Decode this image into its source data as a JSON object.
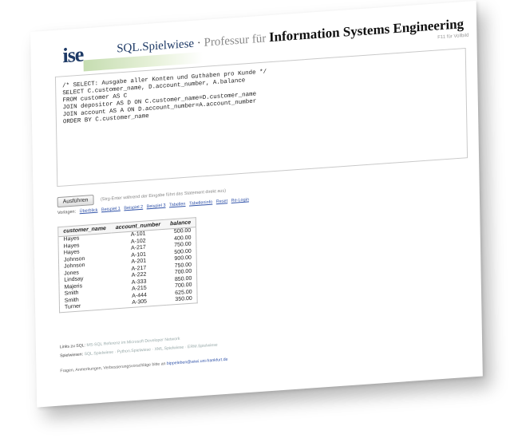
{
  "header": {
    "app_name": "SQL.Spielwiese",
    "separator": " · ",
    "prof_text": "Professur für",
    "ise_text": "Information Systems Engineering",
    "logo_text": "ise",
    "topright": "F11 für Vollbild"
  },
  "editor": {
    "sql": "/* SELECT: Ausgabe aller Konten und Guthaben pro Kunde */\nSELECT C.customer_name, D.account_number, A.balance\nFROM customer AS C\nJOIN depositor AS D ON C.customer_name=D.customer_name\nJOIN account AS A ON D.account_number=A.account_number\nORDER BY C.customer_name"
  },
  "run": {
    "button_label": "Ausführen",
    "hint": "(Strg-Enter während der Eingabe führt das Statement direkt aus)"
  },
  "templates": {
    "label": "Vorlagen:",
    "links": [
      "Überblick",
      "Beispiel 1",
      "Beispiel 2",
      "Beispiel 3",
      "Tabellen",
      "Tabelleninfo",
      "Reset",
      "Re-Login"
    ]
  },
  "results": {
    "columns": [
      "customer_name",
      "account_number",
      "balance"
    ],
    "rows": [
      [
        "Hayes",
        "A-101",
        "500.00"
      ],
      [
        "Hayes",
        "A-102",
        "400.00"
      ],
      [
        "Hayes",
        "A-217",
        "750.00"
      ],
      [
        "Johnson",
        "A-101",
        "500.00"
      ],
      [
        "Johnson",
        "A-201",
        "900.00"
      ],
      [
        "Jones",
        "A-217",
        "750.00"
      ],
      [
        "Lindsay",
        "A-222",
        "700.00"
      ],
      [
        "Majeris",
        "A-333",
        "850.00"
      ],
      [
        "Smith",
        "A-215",
        "700.00"
      ],
      [
        "Smith",
        "A-444",
        "625.00"
      ],
      [
        "Turner",
        "A-305",
        "350.00"
      ]
    ]
  },
  "footer": {
    "links_label": "Links zu SQL:",
    "links_text": "MS-SQL Referenz im Microsoft Developer Network",
    "spiel_label": "Spielwiesen:",
    "spiel_text": "SQL.Spielwiese · Python.Spielwiese · XML.Spielwiese · ERM.Spielwiese",
    "contact_text": "Fragen, Anmerkungen, Verbesserungsvorschläge bitte an",
    "contact_email": "bippeleben@wiwi.uni-frankfurt.de"
  }
}
